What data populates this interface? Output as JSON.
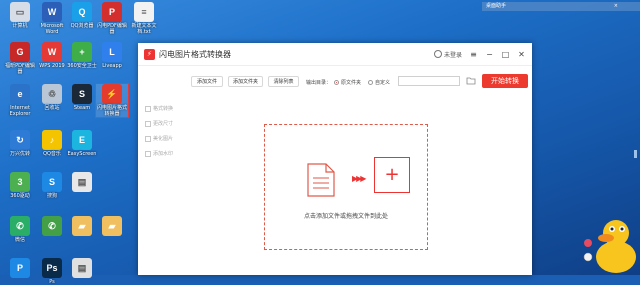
{
  "corner_bar": {
    "text": "桌面助手"
  },
  "desktop_icons": [
    {
      "label": "计算机",
      "color": "#d7dde6",
      "glyph": "▭"
    },
    {
      "label": "Microsoft Word",
      "color": "#2b5fb8",
      "glyph": "W"
    },
    {
      "label": "QQ浏览器",
      "color": "#1aa0e8",
      "glyph": "Q"
    },
    {
      "label": "闪电PDF编辑器",
      "color": "#d32f2f",
      "glyph": "P"
    },
    {
      "label": "新建文本文档.txt",
      "color": "#f2f2f2",
      "glyph": "≡"
    },
    {
      "label": "福昕PDF编辑器",
      "color": "#c62828",
      "glyph": "G"
    },
    {
      "label": "WPS 2019",
      "color": "#e53935",
      "glyph": "W"
    },
    {
      "label": "360安全卫士",
      "color": "#3fae49",
      "glyph": "+"
    },
    {
      "label": "Liveapp",
      "color": "#2f80ed",
      "glyph": "L"
    },
    {
      "label": "Internet Explorer",
      "color": "#2a73c9",
      "glyph": "e"
    },
    {
      "label": "回收站",
      "color": "#b8c6d6",
      "glyph": "♲"
    },
    {
      "label": "Steam",
      "color": "#1b2838",
      "glyph": "S"
    },
    {
      "label": "闪电图片格式转换器",
      "color": "#e33b2e",
      "glyph": "⚡"
    },
    {
      "label": "万兴优转",
      "color": "#2e7bd6",
      "glyph": "↻"
    },
    {
      "label": "QQ音乐",
      "color": "#f5c400",
      "glyph": "♪"
    },
    {
      "label": "EasyScreen",
      "color": "#1cb5e0",
      "glyph": "E"
    },
    {
      "label": "360驱动",
      "color": "#4caf50",
      "glyph": "3"
    },
    {
      "label": "搜狗",
      "color": "#1e88e5",
      "glyph": "S"
    },
    {
      "label": "",
      "color": "#e8e8e8",
      "glyph": "▤"
    },
    {
      "label": "微信",
      "color": "#2aae67",
      "glyph": "✆"
    },
    {
      "label": "",
      "color": "#43a047",
      "glyph": "✆"
    },
    {
      "label": "",
      "color": "#f0c060",
      "glyph": "▰"
    },
    {
      "label": "",
      "color": "#f0c060",
      "glyph": "▰"
    },
    {
      "label": "",
      "color": "#1e88e5",
      "glyph": "P"
    },
    {
      "label": "Ps",
      "color": "#0a2a4a",
      "glyph": "Ps"
    },
    {
      "label": "",
      "color": "#e0e0e0",
      "glyph": "▤"
    }
  ],
  "window": {
    "title": "闪电图片格式转换器",
    "user_label": "未登录",
    "minimize_glyph": "−",
    "restore_glyph": "□",
    "close_glyph": "✕",
    "menu_glyph": "≡",
    "add_file": "添加文件",
    "add_folder": "添加文件夹",
    "clear_list": "清除列表",
    "output_dir_label": "输出目录：",
    "radio_original": "原文件夹",
    "radio_custom": "自定义",
    "path_value": "",
    "start_button": "开始转换",
    "side_items": [
      "格式转换",
      "更改尺寸",
      "美化图片",
      "添加水印"
    ],
    "drop_hint": "点击添加文件或拖拽文件到此处",
    "arrows": "▶▶▶",
    "plus": "+"
  },
  "colors": {
    "accent": "#ec3a2e",
    "border_dash": "#e05a4a"
  }
}
